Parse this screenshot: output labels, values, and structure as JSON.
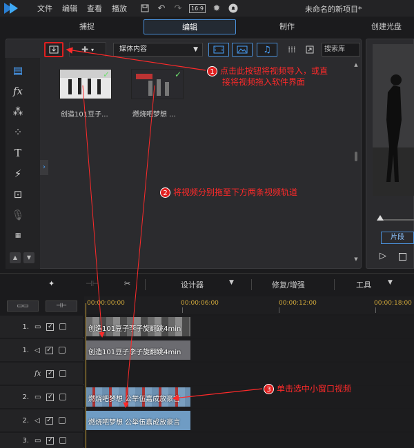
{
  "menu": {
    "items": [
      "文件",
      "编辑",
      "查看",
      "播放"
    ],
    "aspect_ratio": "16:9",
    "project_name": "未命名的新项目*"
  },
  "modes": [
    "捕捉",
    "编辑",
    "制作",
    "创建光盘"
  ],
  "library": {
    "dropdown_value": "媒体内容",
    "search_placeholder": "搜索库",
    "clips": [
      {
        "caption": "创造101豆子..."
      },
      {
        "caption": "燃烧吧梦想 ..."
      }
    ]
  },
  "preview": {
    "clip_button": "片段"
  },
  "timeline_toolbar": {
    "designer": "设计器",
    "fix_enhance": "修复/增强",
    "tools": "工具"
  },
  "ruler": [
    "00:00:00:00",
    "00:00:06:00",
    "00:00:12:00",
    "00:00:18:00"
  ],
  "tracks": [
    {
      "num": "1.",
      "kind": "video",
      "clip": "创造101豆子李子旋翻跳4min"
    },
    {
      "num": "1.",
      "kind": "audio",
      "clip": "创造101豆子李子旋翻跳4min"
    },
    {
      "num": "",
      "kind": "fx",
      "clip": ""
    },
    {
      "num": "2.",
      "kind": "video",
      "clip": "燃烧吧梦想 公举伍嘉成放豪言"
    },
    {
      "num": "2.",
      "kind": "audio",
      "clip": "燃烧吧梦想 公举伍嘉成放豪言"
    },
    {
      "num": "3.",
      "kind": "video",
      "clip": ""
    }
  ],
  "annotations": {
    "step1_num": "1",
    "step1_line1": "点击此按钮将视频导入，或直",
    "step1_line2": "接将视频拖入软件界面",
    "step2_num": "2",
    "step2_text": "将视频分别拖至下方两条视频轨道",
    "step3_num": "3",
    "step3_text": "单击选中小窗口视频"
  },
  "colors": {
    "accent": "#4a90d9",
    "annotation": "#ff2a2a",
    "ruler_text": "#d2a93a"
  }
}
